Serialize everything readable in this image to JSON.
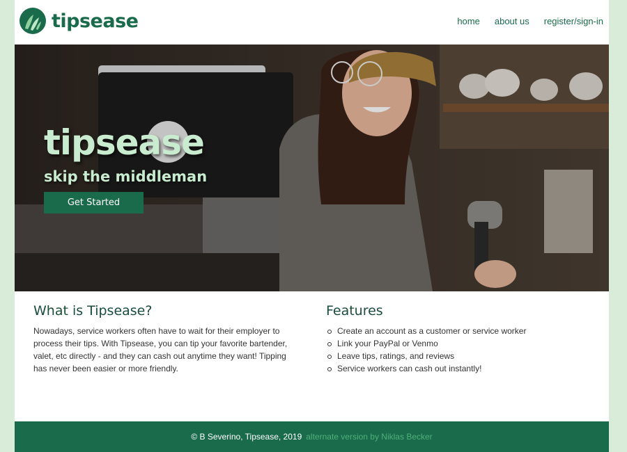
{
  "brand": {
    "name": "tipsease",
    "logo_icon": "leaf-hand-icon"
  },
  "nav": [
    {
      "label": "home"
    },
    {
      "label": "about us"
    },
    {
      "label": "register/sign-in"
    }
  ],
  "hero": {
    "title": "tipsease",
    "subtitle": "skip the middleman",
    "cta_label": "Get Started"
  },
  "about": {
    "heading": "What is Tipsease?",
    "body": "Nowadays, service workers often have to wait for their employer to process their tips. With Tipsease, you can tip your favorite bartender, valet, etc directly - and they can cash out anytime they want! Tipping has never been easier or more friendly."
  },
  "features": {
    "heading": "Features",
    "items": [
      "Create an account as a customer or service worker",
      "Link your PayPal or Venmo",
      "Leave tips, ratings, and reviews",
      "Service workers can cash out instantly!"
    ]
  },
  "footer": {
    "copyright": "© B Severino, Tipsease, 2019",
    "link": "alternate version by Niklas Becker"
  },
  "colors": {
    "brand_green": "#1a6b4c",
    "hero_text": "#c9ebcf",
    "page_bg": "#d8ecd9"
  }
}
